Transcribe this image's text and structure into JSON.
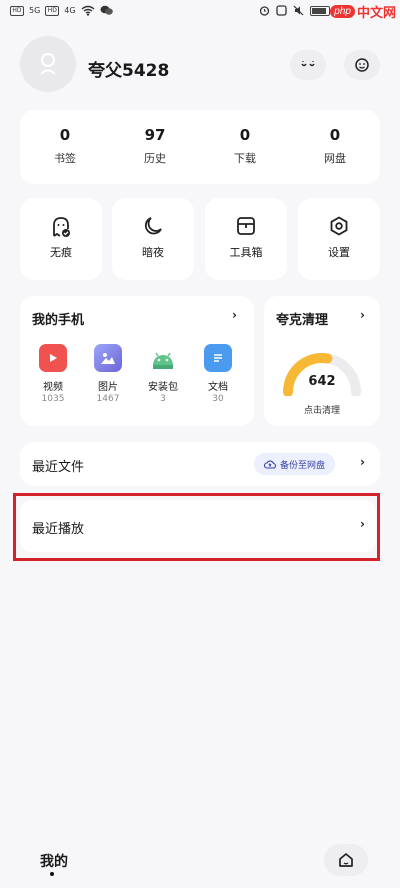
{
  "status_bar": {
    "sim_labels": [
      "HD",
      "HD"
    ],
    "signal_texts": [
      "5G",
      "4G"
    ],
    "watermark_logo": "php",
    "watermark_text": "中文网"
  },
  "profile": {
    "username": "夸父5428"
  },
  "stats": [
    {
      "value": "0",
      "label": "书签"
    },
    {
      "value": "97",
      "label": "历史"
    },
    {
      "value": "0",
      "label": "下载"
    },
    {
      "value": "0",
      "label": "网盘"
    }
  ],
  "tools": [
    {
      "label": "无痕",
      "icon": "ghost-icon"
    },
    {
      "label": "暗夜",
      "icon": "moon-icon"
    },
    {
      "label": "工具箱",
      "icon": "toolbox-icon"
    },
    {
      "label": "设置",
      "icon": "settings-icon"
    }
  ],
  "my_phone": {
    "title": "我的手机",
    "apps": [
      {
        "name": "视频",
        "count": "1035",
        "color": "#f0524f",
        "icon": "video-icon"
      },
      {
        "name": "图片",
        "count": "1467",
        "color": "#7a7ef0",
        "icon": "image-icon"
      },
      {
        "name": "安装包",
        "count": "3",
        "color": "#5ec489",
        "icon": "android-icon"
      },
      {
        "name": "文档",
        "count": "30",
        "color": "#4a9af0",
        "icon": "document-icon"
      }
    ]
  },
  "cleaner": {
    "title": "夸克清理",
    "value": "642",
    "subtitle": "点击清理",
    "gauge_fraction": 0.55,
    "gauge_color": "#f6b835"
  },
  "recent_files": {
    "label": "最近文件",
    "backup_label": "备份至网盘"
  },
  "recent_play": {
    "label": "最近播放"
  },
  "highlight_color": "#d3222a",
  "bottom_nav": {
    "mine_label": "我的",
    "home_icon": "home-icon"
  }
}
